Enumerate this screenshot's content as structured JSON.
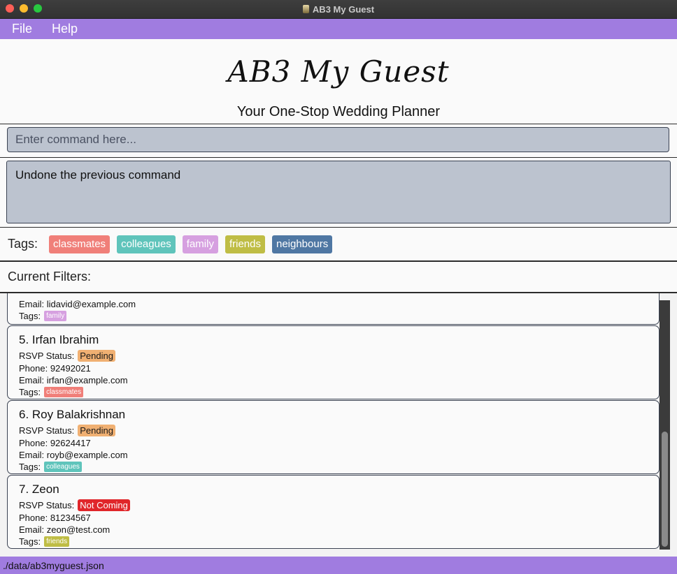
{
  "window": {
    "title": "AB3 My Guest"
  },
  "menu": {
    "file": "File",
    "help": "Help"
  },
  "header": {
    "logo": "AB3 My Guest",
    "subtitle": "Your One-Stop Wedding Planner"
  },
  "command": {
    "placeholder": "Enter command here..."
  },
  "result": {
    "message": "Undone the previous command"
  },
  "tags_bar": {
    "label": "Tags:",
    "tags": [
      {
        "name": "classmates",
        "color": "#f07f79"
      },
      {
        "name": "colleagues",
        "color": "#5fc4bb"
      },
      {
        "name": "family",
        "color": "#d6a0e0"
      },
      {
        "name": "friends",
        "color": "#bfbd45"
      },
      {
        "name": "neighbours",
        "color": "#4f77a3"
      }
    ]
  },
  "filters": {
    "label": "Current Filters:"
  },
  "colors": {
    "accent": "#a07ce0",
    "pending": "#f0b072",
    "not_coming": "#e0262a"
  },
  "guests": [
    {
      "partial": true,
      "email_label": "Email:",
      "email": "lidavid@example.com",
      "tags_label": "Tags:",
      "tag": "family",
      "tag_color": "#d6a0e0"
    },
    {
      "name": "5. Irfan Ibrahim",
      "rsvp_label": "RSVP Status:",
      "rsvp": "Pending",
      "rsvp_color": "#f0b072",
      "rsvp_text_color": "#1a1a1a",
      "phone_label": "Phone:",
      "phone": "92492021",
      "email_label": "Email:",
      "email": "irfan@example.com",
      "tags_label": "Tags:",
      "tag": "classmates",
      "tag_color": "#f07f79"
    },
    {
      "name": "6. Roy Balakrishnan",
      "rsvp_label": "RSVP Status:",
      "rsvp": "Pending",
      "rsvp_color": "#f0b072",
      "rsvp_text_color": "#1a1a1a",
      "phone_label": "Phone:",
      "phone": "92624417",
      "email_label": "Email:",
      "email": "royb@example.com",
      "tags_label": "Tags:",
      "tag": "colleagues",
      "tag_color": "#5fc4bb"
    },
    {
      "name": "7. Zeon",
      "rsvp_label": "RSVP Status:",
      "rsvp": "Not Coming",
      "rsvp_color": "#e0262a",
      "rsvp_text_color": "#ffffff",
      "phone_label": "Phone:",
      "phone": "81234567",
      "email_label": "Email:",
      "email": "zeon@test.com",
      "tags_label": "Tags:",
      "tag": "friends",
      "tag_color": "#bfbd45"
    }
  ],
  "status": {
    "path": "./data/ab3myguest.json"
  }
}
